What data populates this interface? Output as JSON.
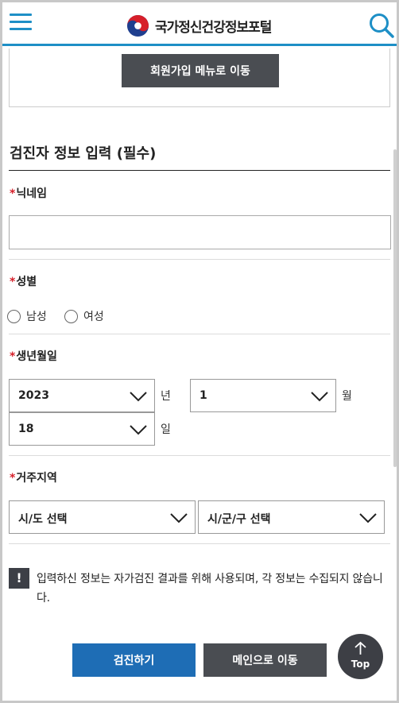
{
  "header": {
    "site_title": "국가정신건강정보포털",
    "menu_icon": "hamburger-menu-icon",
    "search_icon": "search-icon",
    "accent_color": "#1e8fc6"
  },
  "join": {
    "button_label": "회원가입 메뉴로 이동"
  },
  "form": {
    "section_title": "검진자 정보 입력 (필수)",
    "required_mark": "*",
    "nickname": {
      "label": "닉네임",
      "value": "",
      "placeholder": ""
    },
    "gender": {
      "label": "성별",
      "options": [
        "남성",
        "여성"
      ],
      "selected": null
    },
    "birth": {
      "label": "생년월일",
      "year": "2023",
      "year_unit": "년",
      "month": "1",
      "month_unit": "월",
      "day": "18",
      "day_unit": "일"
    },
    "region": {
      "label": "거주지역",
      "sido": "시/도 선택",
      "sigungu": "시/군/구 선택"
    }
  },
  "notice": {
    "icon": "!",
    "text": "입력하신 정보는 자가검진 결과를 위해 사용되며, 각 정보는 수집되지 않습니다."
  },
  "actions": {
    "check_label": "검진하기",
    "home_label": "메인으로 이동",
    "check_color": "#1e6db5",
    "home_color": "#4a4d52"
  },
  "top_button": {
    "label": "Top"
  }
}
